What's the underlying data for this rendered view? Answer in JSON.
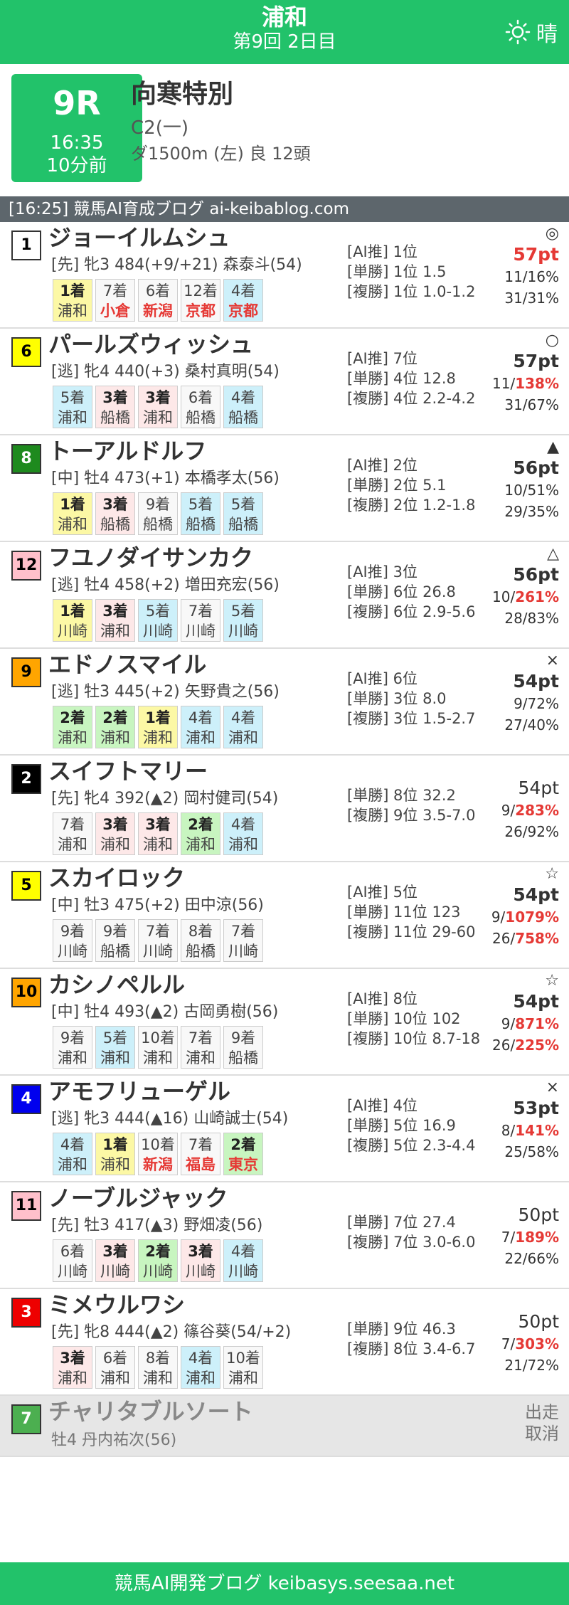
{
  "header": {
    "venue": "浦和",
    "session": "第9回 2日目",
    "weather": "晴",
    "weather_icon": "sun-icon"
  },
  "race": {
    "number": "9R",
    "time": "16:35",
    "until": "10分前",
    "name": "向寒特別",
    "class": "C2(一)",
    "conditions": "ダ1500m (左) 良 12頭"
  },
  "blog_bar": "[16:25] 競馬AI育成ブログ ai-keibablog.com",
  "footer": "競馬AI開発ブログ keibasys.seesaa.net",
  "colors": {
    "accent": "#22c26a",
    "red": "#e53935"
  },
  "entries": [
    {
      "num": "1",
      "num_color": "#ffffff",
      "num_text": "#000000",
      "name": "ジョーイルムシュ",
      "detail": "[先] 牝3 484(+9/+21) 森泰斗(54)",
      "results": [
        {
          "p": "1着",
          "v": "浦和",
          "rank": 1
        },
        {
          "p": "7着",
          "v": "小倉",
          "rank": 7,
          "red": true
        },
        {
          "p": "6着",
          "v": "新潟",
          "rank": 6,
          "red": true
        },
        {
          "p": "12着",
          "v": "京都",
          "rank": 12,
          "red": true
        },
        {
          "p": "4着",
          "v": "京都",
          "rank": 4,
          "red": true
        }
      ],
      "ai": "[AI推] 1位",
      "win": "[単勝] 1位 1.5",
      "place": "[複勝] 1位 1.0-1.2",
      "mark": "◎",
      "pt": "57pt",
      "pt_style": "red",
      "rate1": "11/16%",
      "rate1_hi": false,
      "rate2": "31/31%",
      "rate2_hi": false
    },
    {
      "num": "6",
      "num_color": "#ffff00",
      "num_text": "#000000",
      "name": "パールズウィッシュ",
      "detail": "[逃] 牝4 440(+3) 桑村真明(54)",
      "results": [
        {
          "p": "5着",
          "v": "浦和",
          "rank": 5
        },
        {
          "p": "3着",
          "v": "船橋",
          "rank": 3
        },
        {
          "p": "3着",
          "v": "浦和",
          "rank": 3
        },
        {
          "p": "6着",
          "v": "船橋",
          "rank": 6
        },
        {
          "p": "4着",
          "v": "船橋",
          "rank": 4
        }
      ],
      "ai": "[AI推] 7位",
      "win": "[単勝] 4位 12.8",
      "place": "[複勝] 4位 2.2-4.2",
      "mark": "○",
      "pt": "57pt",
      "pt_style": "bold",
      "rate1": "11/138%",
      "rate1_hi": true,
      "rate2": "31/67%",
      "rate2_hi": false
    },
    {
      "num": "8",
      "num_color": "#1e8a1e",
      "num_text": "#ffffff",
      "name": "トーアルドルフ",
      "detail": "[中] 牡4 473(+1) 本橋孝太(56)",
      "results": [
        {
          "p": "1着",
          "v": "浦和",
          "rank": 1
        },
        {
          "p": "3着",
          "v": "船橋",
          "rank": 3
        },
        {
          "p": "9着",
          "v": "船橋",
          "rank": 9
        },
        {
          "p": "5着",
          "v": "船橋",
          "rank": 5
        },
        {
          "p": "5着",
          "v": "船橋",
          "rank": 5
        }
      ],
      "ai": "[AI推] 2位",
      "win": "[単勝] 2位 5.1",
      "place": "[複勝] 2位 1.2-1.8",
      "mark": "▲",
      "pt": "56pt",
      "pt_style": "bold",
      "rate1": "10/51%",
      "rate1_hi": false,
      "rate2": "29/35%",
      "rate2_hi": false
    },
    {
      "num": "12",
      "num_color": "#ffc0cb",
      "num_text": "#000000",
      "name": "フユノダイサンカク",
      "detail": "[逃] 牡4 458(+2) 増田充宏(56)",
      "results": [
        {
          "p": "1着",
          "v": "川崎",
          "rank": 1
        },
        {
          "p": "3着",
          "v": "浦和",
          "rank": 3
        },
        {
          "p": "5着",
          "v": "川崎",
          "rank": 5
        },
        {
          "p": "7着",
          "v": "川崎",
          "rank": 7
        },
        {
          "p": "5着",
          "v": "川崎",
          "rank": 5
        }
      ],
      "ai": "[AI推] 3位",
      "win": "[単勝] 6位 26.8",
      "place": "[複勝] 6位 2.9-5.6",
      "mark": "△",
      "pt": "56pt",
      "pt_style": "bold",
      "rate1": "10/261%",
      "rate1_hi": true,
      "rate2": "28/83%",
      "rate2_hi": false
    },
    {
      "num": "9",
      "num_color": "#ffa500",
      "num_text": "#000000",
      "name": "エドノスマイル",
      "detail": "[逃] 牡3 445(+2) 矢野貴之(56)",
      "results": [
        {
          "p": "2着",
          "v": "浦和",
          "rank": 2
        },
        {
          "p": "2着",
          "v": "浦和",
          "rank": 2
        },
        {
          "p": "1着",
          "v": "浦和",
          "rank": 1
        },
        {
          "p": "4着",
          "v": "浦和",
          "rank": 4
        },
        {
          "p": "4着",
          "v": "浦和",
          "rank": 4
        }
      ],
      "ai": "[AI推] 6位",
      "win": "[単勝] 3位 8.0",
      "place": "[複勝] 3位 1.5-2.7",
      "mark": "×",
      "pt": "54pt",
      "pt_style": "bold",
      "rate1": "9/72%",
      "rate1_hi": false,
      "rate2": "27/40%",
      "rate2_hi": false
    },
    {
      "num": "2",
      "num_color": "#000000",
      "num_text": "#ffffff",
      "name": "スイフトマリー",
      "detail": "[先] 牝4 392(▲2) 岡村健司(54)",
      "results": [
        {
          "p": "7着",
          "v": "浦和",
          "rank": 7
        },
        {
          "p": "3着",
          "v": "浦和",
          "rank": 3
        },
        {
          "p": "3着",
          "v": "浦和",
          "rank": 3
        },
        {
          "p": "2着",
          "v": "浦和",
          "rank": 2
        },
        {
          "p": "4着",
          "v": "浦和",
          "rank": 4
        }
      ],
      "ai": "",
      "win": "[単勝] 8位 32.2",
      "place": "[複勝] 9位 3.5-7.0",
      "mark": "",
      "pt": "54pt",
      "pt_style": "plain",
      "rate1": "9/283%",
      "rate1_hi": true,
      "rate2": "26/92%",
      "rate2_hi": false
    },
    {
      "num": "5",
      "num_color": "#ffff00",
      "num_text": "#000000",
      "name": "スカイロック",
      "detail": "[中] 牡3 475(+2) 田中涼(56)",
      "results": [
        {
          "p": "9着",
          "v": "川崎",
          "rank": 9
        },
        {
          "p": "9着",
          "v": "船橋",
          "rank": 9
        },
        {
          "p": "7着",
          "v": "川崎",
          "rank": 7
        },
        {
          "p": "8着",
          "v": "船橋",
          "rank": 8
        },
        {
          "p": "7着",
          "v": "川崎",
          "rank": 7
        }
      ],
      "ai": "[AI推] 5位",
      "win": "[単勝] 11位 123",
      "place": "[複勝] 11位 29-60",
      "mark": "☆",
      "pt": "54pt",
      "pt_style": "bold",
      "rate1": "9/1079%",
      "rate1_hi": true,
      "rate2": "26/758%",
      "rate2_hi": true
    },
    {
      "num": "10",
      "num_color": "#ffa500",
      "num_text": "#000000",
      "name": "カシノペルル",
      "detail": "[中] 牡4 493(▲2) 古岡勇樹(56)",
      "results": [
        {
          "p": "9着",
          "v": "浦和",
          "rank": 9
        },
        {
          "p": "5着",
          "v": "浦和",
          "rank": 5
        },
        {
          "p": "10着",
          "v": "浦和",
          "rank": 10
        },
        {
          "p": "7着",
          "v": "浦和",
          "rank": 7
        },
        {
          "p": "9着",
          "v": "船橋",
          "rank": 9
        }
      ],
      "ai": "[AI推] 8位",
      "win": "[単勝] 10位 102",
      "place": "[複勝] 10位 8.7-18",
      "mark": "☆",
      "pt": "54pt",
      "pt_style": "bold",
      "rate1": "9/871%",
      "rate1_hi": true,
      "rate2": "26/225%",
      "rate2_hi": true
    },
    {
      "num": "4",
      "num_color": "#0000ee",
      "num_text": "#ffffff",
      "name": "アモフリューゲル",
      "detail": "[逃] 牝3 444(▲16) 山崎誠士(54)",
      "results": [
        {
          "p": "4着",
          "v": "浦和",
          "rank": 4
        },
        {
          "p": "1着",
          "v": "浦和",
          "rank": 1
        },
        {
          "p": "10着",
          "v": "新潟",
          "rank": 10,
          "red": true
        },
        {
          "p": "7着",
          "v": "福島",
          "rank": 7,
          "red": true
        },
        {
          "p": "2着",
          "v": "東京",
          "rank": 2,
          "red": true
        }
      ],
      "ai": "[AI推] 4位",
      "win": "[単勝] 5位 16.9",
      "place": "[複勝] 5位 2.3-4.4",
      "mark": "×",
      "pt": "53pt",
      "pt_style": "bold",
      "rate1": "8/141%",
      "rate1_hi": true,
      "rate2": "25/58%",
      "rate2_hi": false
    },
    {
      "num": "11",
      "num_color": "#ffc0cb",
      "num_text": "#000000",
      "name": "ノーブルジャック",
      "detail": "[先] 牡3 417(▲3) 野畑凌(56)",
      "results": [
        {
          "p": "6着",
          "v": "川崎",
          "rank": 6
        },
        {
          "p": "3着",
          "v": "川崎",
          "rank": 3
        },
        {
          "p": "2着",
          "v": "川崎",
          "rank": 2
        },
        {
          "p": "3着",
          "v": "川崎",
          "rank": 3
        },
        {
          "p": "4着",
          "v": "川崎",
          "rank": 4
        }
      ],
      "ai": "",
      "win": "[単勝] 7位 27.4",
      "place": "[複勝] 7位 3.0-6.0",
      "mark": "",
      "pt": "50pt",
      "pt_style": "plain",
      "rate1": "7/189%",
      "rate1_hi": true,
      "rate2": "22/66%",
      "rate2_hi": false
    },
    {
      "num": "3",
      "num_color": "#ee0000",
      "num_text": "#ffffff",
      "name": "ミメウルワシ",
      "detail": "[先] 牝8 444(▲2) 篠谷葵(54/+2)",
      "results": [
        {
          "p": "3着",
          "v": "浦和",
          "rank": 3
        },
        {
          "p": "6着",
          "v": "浦和",
          "rank": 6
        },
        {
          "p": "8着",
          "v": "浦和",
          "rank": 8
        },
        {
          "p": "4着",
          "v": "浦和",
          "rank": 4
        },
        {
          "p": "10着",
          "v": "浦和",
          "rank": 10
        }
      ],
      "ai": "",
      "win": "[単勝] 9位 46.3",
      "place": "[複勝] 8位 3.4-6.7",
      "mark": "",
      "pt": "50pt",
      "pt_style": "plain",
      "rate1": "7/303%",
      "rate1_hi": true,
      "rate2": "21/72%",
      "rate2_hi": false
    }
  ],
  "scratched": {
    "num": "7",
    "num_color": "#4caf50",
    "num_text": "#ffffff",
    "name": "チャリタブルソート",
    "detail": "牡4 丹内祐次(56)",
    "status1": "出走",
    "status2": "取消"
  }
}
